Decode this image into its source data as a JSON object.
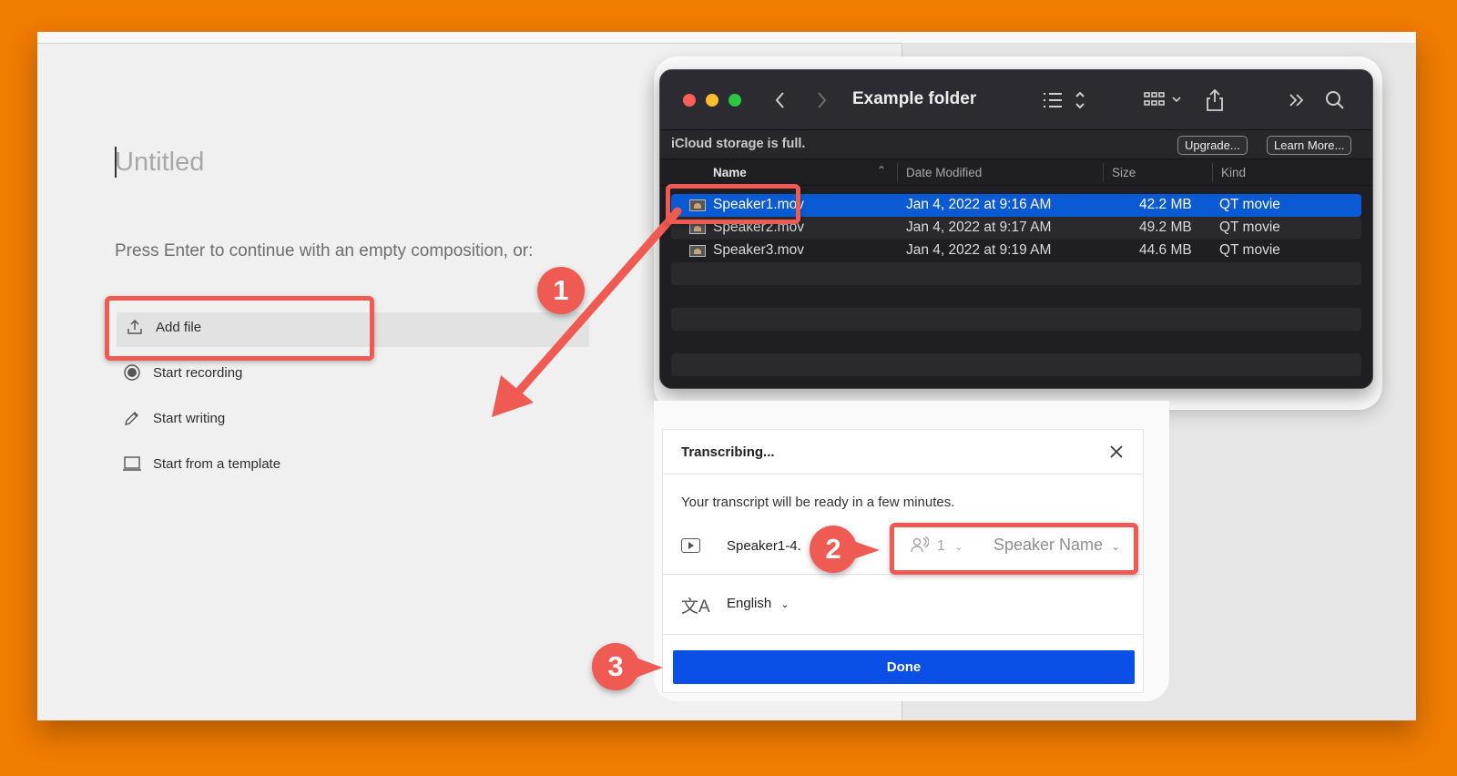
{
  "editor": {
    "title_placeholder": "Untitled",
    "hint": "Press Enter to continue with an empty composition, or:",
    "options": [
      {
        "label": "Add file",
        "icon": "upload-icon"
      },
      {
        "label": "Start recording",
        "icon": "record-icon"
      },
      {
        "label": "Start writing",
        "icon": "pencil-icon"
      },
      {
        "label": "Start from a template",
        "icon": "template-icon"
      }
    ]
  },
  "finder": {
    "title": "Example folder",
    "banner": {
      "message": "iCloud storage is full.",
      "upgrade": "Upgrade...",
      "learn_more": "Learn More..."
    },
    "columns": {
      "name": "Name",
      "date": "Date Modified",
      "size": "Size",
      "kind": "Kind"
    },
    "files": [
      {
        "name": "Speaker1.mov",
        "date": "Jan 4, 2022 at 9:16 AM",
        "size": "42.2 MB",
        "kind": "QT movie",
        "selected": true
      },
      {
        "name": "Speaker2.mov",
        "date": "Jan 4, 2022 at 9:17 AM",
        "size": "49.2 MB",
        "kind": "QT movie",
        "selected": false
      },
      {
        "name": "Speaker3.mov",
        "date": "Jan 4, 2022 at 9:19 AM",
        "size": "44.6 MB",
        "kind": "QT movie",
        "selected": false
      }
    ]
  },
  "dialog": {
    "title": "Transcribing...",
    "subtitle": "Your transcript will be ready in a few minutes.",
    "file_name": "Speaker1-4.",
    "speaker_count": "1",
    "speaker_name": "Speaker Name",
    "language": "English",
    "done_label": "Done"
  },
  "annotations": {
    "step1": "1",
    "step2": "2",
    "step3": "3"
  },
  "colors": {
    "background": "#f07c00",
    "annotation": "#ef5a52",
    "selection": "#0a5ad3",
    "done_button": "#0a4fe6"
  }
}
